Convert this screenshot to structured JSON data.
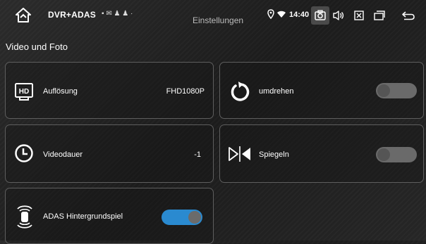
{
  "status_bar": {
    "app_title": "DVR+ADAS",
    "notifications": "▪ ✉ ♟ ♟ ·",
    "page_title": "Einstellungen",
    "time": "14:40",
    "active_button": "camera-icon"
  },
  "section": {
    "title": "Video und Foto"
  },
  "cards": {
    "resolution": {
      "label": "Auflösung",
      "value": "FHD1080P",
      "icon": "hd-icon"
    },
    "rotate": {
      "label": "umdrehen",
      "icon": "rotate-icon",
      "toggle_on": false
    },
    "duration": {
      "label": "Videodauer",
      "value": "-1",
      "icon": "clock-icon"
    },
    "mirror": {
      "label": "Spiegeln",
      "icon": "mirror-icon",
      "toggle_on": false
    },
    "adas": {
      "label": "ADAS Hintergrundspiel",
      "icon": "adas-car-icon",
      "toggle_on": true
    }
  },
  "colors": {
    "toggle_on": "#2a8ad0",
    "toggle_off": "#6a6a6a",
    "card_border": "#5e5e5e"
  }
}
